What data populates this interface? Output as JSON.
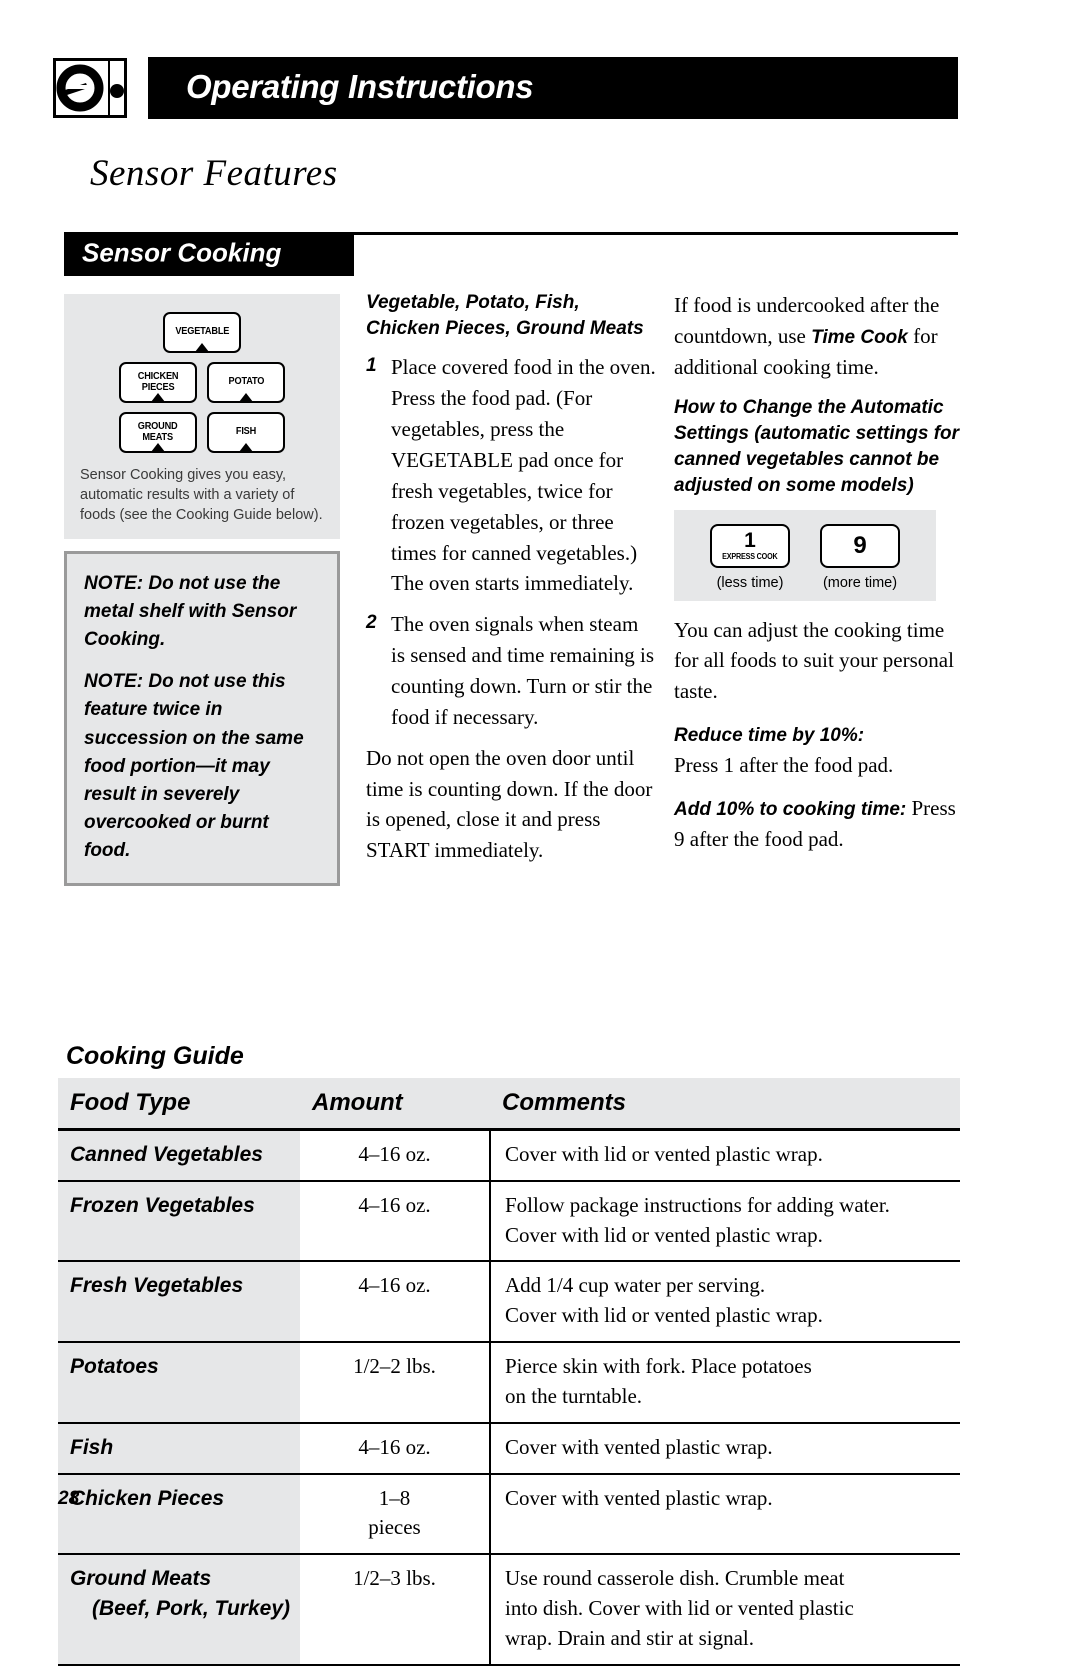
{
  "header": {
    "title": "Operating Instructions",
    "logo_icon": "ge-dial-logo-icon"
  },
  "section": {
    "title": "Sensor Features",
    "band_label": "Sensor Cooking"
  },
  "pad_panel": {
    "pads": [
      {
        "label": "VEGETABLE"
      },
      {
        "label": "CHICKEN\nPIECES"
      },
      {
        "label": "POTATO"
      },
      {
        "label": "GROUND\nMEATS"
      },
      {
        "label": "FISH"
      }
    ],
    "caption": "Sensor Cooking gives you easy, automatic results with a variety of foods (see the Cooking Guide below)."
  },
  "note_box": {
    "note1": "NOTE: Do not use the metal shelf with Sensor Cooking.",
    "note2": "NOTE: Do not use this feature twice in succession on the same food portion—it may result in severely overcooked or burnt food."
  },
  "middle_column": {
    "heading": "Vegetable, Potato, Fish, Chicken Pieces, Ground Meats",
    "step1_num": "1",
    "step1_text": "Place covered food in the oven. Press the food pad. (For vegetables, press the VEGETABLE pad once for fresh vegetables, twice for frozen vegetables, or three times for canned vegetables.) The oven starts immediately.",
    "step2_num": "2",
    "step2_text": "The oven signals when steam is sensed and time remaining is counting down. Turn or stir the food if necessary.",
    "para": "Do not open the oven door until time is counting down. If the door is opened, close it and press START immediately."
  },
  "right_column": {
    "para1_a": "If food is undercooked after the countdown, use ",
    "para1_b": "Time Cook",
    "para1_c": " for additional cooking time.",
    "heading": "How to Change the Automatic Settings (automatic settings for canned vegetables cannot be adjusted on some models)",
    "key_panel": {
      "key1_digit": "1",
      "key1_sub": "EXPRESS COOK",
      "key2_digit": "9",
      "cap_less": "(less time)",
      "cap_more": "(more time)"
    },
    "para2": "You can adjust the cooking time for all foods to suit your personal taste.",
    "reduce_label": "Reduce time by 10%:",
    "reduce_text": "Press 1 after the food pad.",
    "add_label": "Add 10% to cooking time:",
    "add_text": " Press 9 after the food pad."
  },
  "cooking_guide": {
    "title": "Cooking Guide",
    "columns": [
      "Food Type",
      "Amount",
      "Comments"
    ],
    "rows": [
      {
        "food": "Canned Vegetables",
        "food_indent": "",
        "amount": "4–16 oz.",
        "comments": [
          "Cover with lid or vented plastic wrap."
        ]
      },
      {
        "food": "Frozen Vegetables",
        "food_indent": "",
        "amount": "4–16 oz.",
        "comments": [
          "Follow package instructions for adding water.",
          "Cover with lid or vented plastic wrap."
        ]
      },
      {
        "food": "Fresh Vegetables",
        "food_indent": "",
        "amount": "4–16 oz.",
        "comments": [
          "Add 1/4 cup water per serving.",
          "Cover with lid or vented plastic wrap."
        ]
      },
      {
        "food": "Potatoes",
        "food_indent": "",
        "amount": "1/2–2 lbs.",
        "comments": [
          "Pierce skin with fork. Place potatoes",
          "on the turntable."
        ]
      },
      {
        "food": "Fish",
        "food_indent": "",
        "amount": "4–16 oz.",
        "comments": [
          "Cover with vented plastic wrap."
        ]
      },
      {
        "food": "Chicken Pieces",
        "food_indent": "",
        "amount": "1–8\npieces",
        "comments": [
          "Cover with vented plastic wrap.",
          ""
        ]
      },
      {
        "food": "Ground Meats",
        "food_indent": "(Beef, Pork, Turkey)",
        "amount": "1/2–3 lbs.",
        "comments": [
          "Use round casserole dish. Crumble meat",
          "into dish. Cover with lid or vented plastic",
          "wrap. Drain and stir at signal."
        ]
      }
    ]
  },
  "footer": {
    "page_number": "28"
  }
}
